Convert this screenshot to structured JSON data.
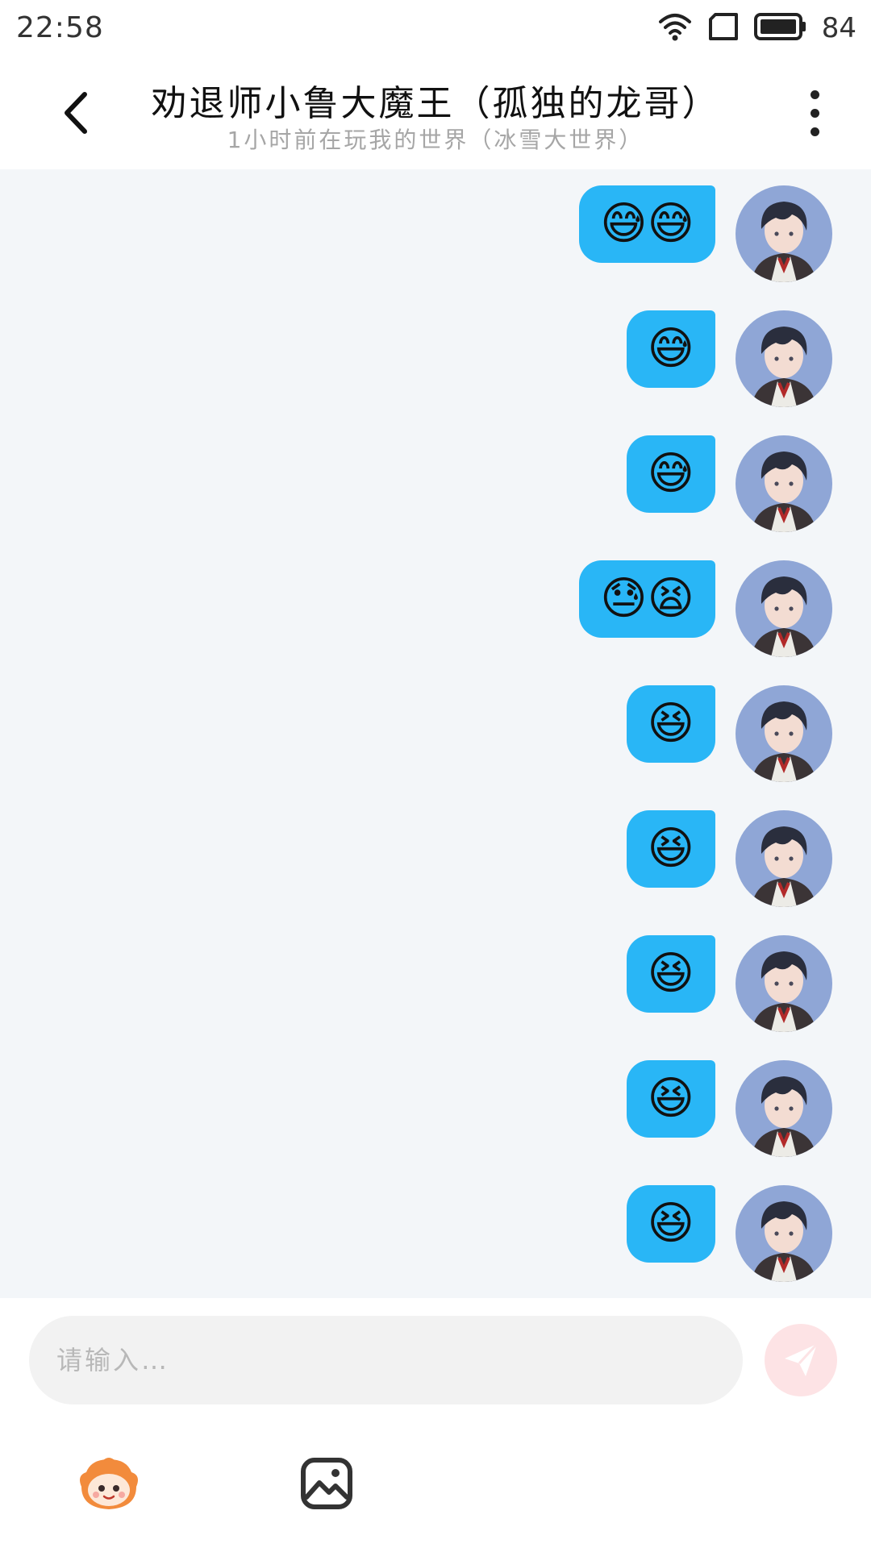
{
  "status_bar": {
    "time": "22:58",
    "battery_level": "84",
    "icons": [
      "wifi-icon",
      "sim-icon",
      "battery-icon"
    ]
  },
  "header": {
    "title": "劝退师小鲁大魔王（孤独的龙哥）",
    "subtitle": "1小时前在玩我的世界（冰雪大世界）",
    "back_icon": "back-chevron-icon",
    "menu_icon": "more-vertical-icon"
  },
  "messages": [
    {
      "emojis": "😅😅"
    },
    {
      "emojis": "😅"
    },
    {
      "emojis": "😅"
    },
    {
      "emojis": "😓😫"
    },
    {
      "emojis": "😆"
    },
    {
      "emojis": "😆"
    },
    {
      "emojis": "😆"
    },
    {
      "emojis": "😆"
    },
    {
      "emojis": "😆"
    }
  ],
  "input": {
    "placeholder": "请输入…",
    "send_icon": "send-icon"
  },
  "toolbar": {
    "items": [
      "sticker-mascot-icon",
      "image-icon"
    ]
  },
  "colors": {
    "bubble": "#29b6f6",
    "chat_background": "#f3f6f9",
    "send_button": "#fde3e5",
    "send_icon": "#ffffff"
  }
}
